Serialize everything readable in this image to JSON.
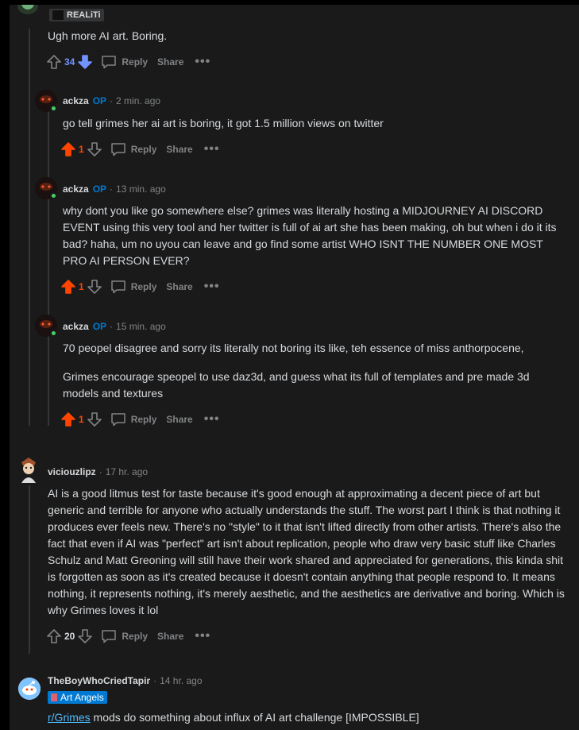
{
  "comments": [
    {
      "flair": "REALiTi",
      "body": "Ugh more AI art. Boring.",
      "score": "34",
      "vote": "down"
    },
    {
      "username": "ackza",
      "op": "OP",
      "time": "2 min. ago",
      "body": "go tell grimes her ai art is boring, it got 1.5 million views on twitter",
      "score": "1",
      "vote": "up"
    },
    {
      "username": "ackza",
      "op": "OP",
      "time": "13 min. ago",
      "body": "why dont you like go somewhere else? grimes was literally hosting a MIDJOURNEY AI DISCORD EVENT using this very tool and her twitter is full of ai art she has been making, oh but when i do it its bad? haha, um no uyou can leave and go find some artist WHO ISNT THE NUMBER ONE MOST PRO AI PERSON EVER?",
      "score": "1",
      "vote": "up"
    },
    {
      "username": "ackza",
      "op": "OP",
      "time": "15 min. ago",
      "body_p1": "70 peopel disagree and sorry its literally not boring its like, teh essence of miss anthorpocene,",
      "body_p2": "Grimes encourage speopel to use daz3d, and guess what its full of templates and pre made 3d models and textures",
      "score": "1",
      "vote": "up"
    },
    {
      "username": "viciouzlipz",
      "time": "17 hr. ago",
      "body": "AI is a good litmus test for taste because it's good enough at approximating a decent piece of art but generic and terrible for anyone who actually understands the stuff. The worst part I think is that nothing it produces ever feels new. There's no \"style\" to it that isn't lifted directly from other artists. There's also the fact that even if AI was \"perfect\" art isn't about replication, people who draw very basic stuff like Charles Schulz and Matt Greoning will still have their work shared and appreciated for generations, this kinda shit is forgotten as soon as it's created because it doesn't contain anything that people respond to. It means nothing, it represents nothing, it's merely aesthetic, and the aesthetics are derivative and boring. Which is why Grimes loves it lol",
      "score": "20",
      "vote": "none"
    },
    {
      "username": "TheBoyWhoCriedTapir",
      "time": "14 hr. ago",
      "flair": "Art Angels",
      "link": "r/Grimes",
      "body": " mods do something about influx of AI art challenge [IMPOSSIBLE]"
    }
  ],
  "labels": {
    "reply": "Reply",
    "share": "Share",
    "more": "•••",
    "separator": "·"
  },
  "colors": {
    "upvote": "#ff4500",
    "downvote": "#7193ff",
    "op": "#0079d3",
    "online": "#46d160"
  }
}
